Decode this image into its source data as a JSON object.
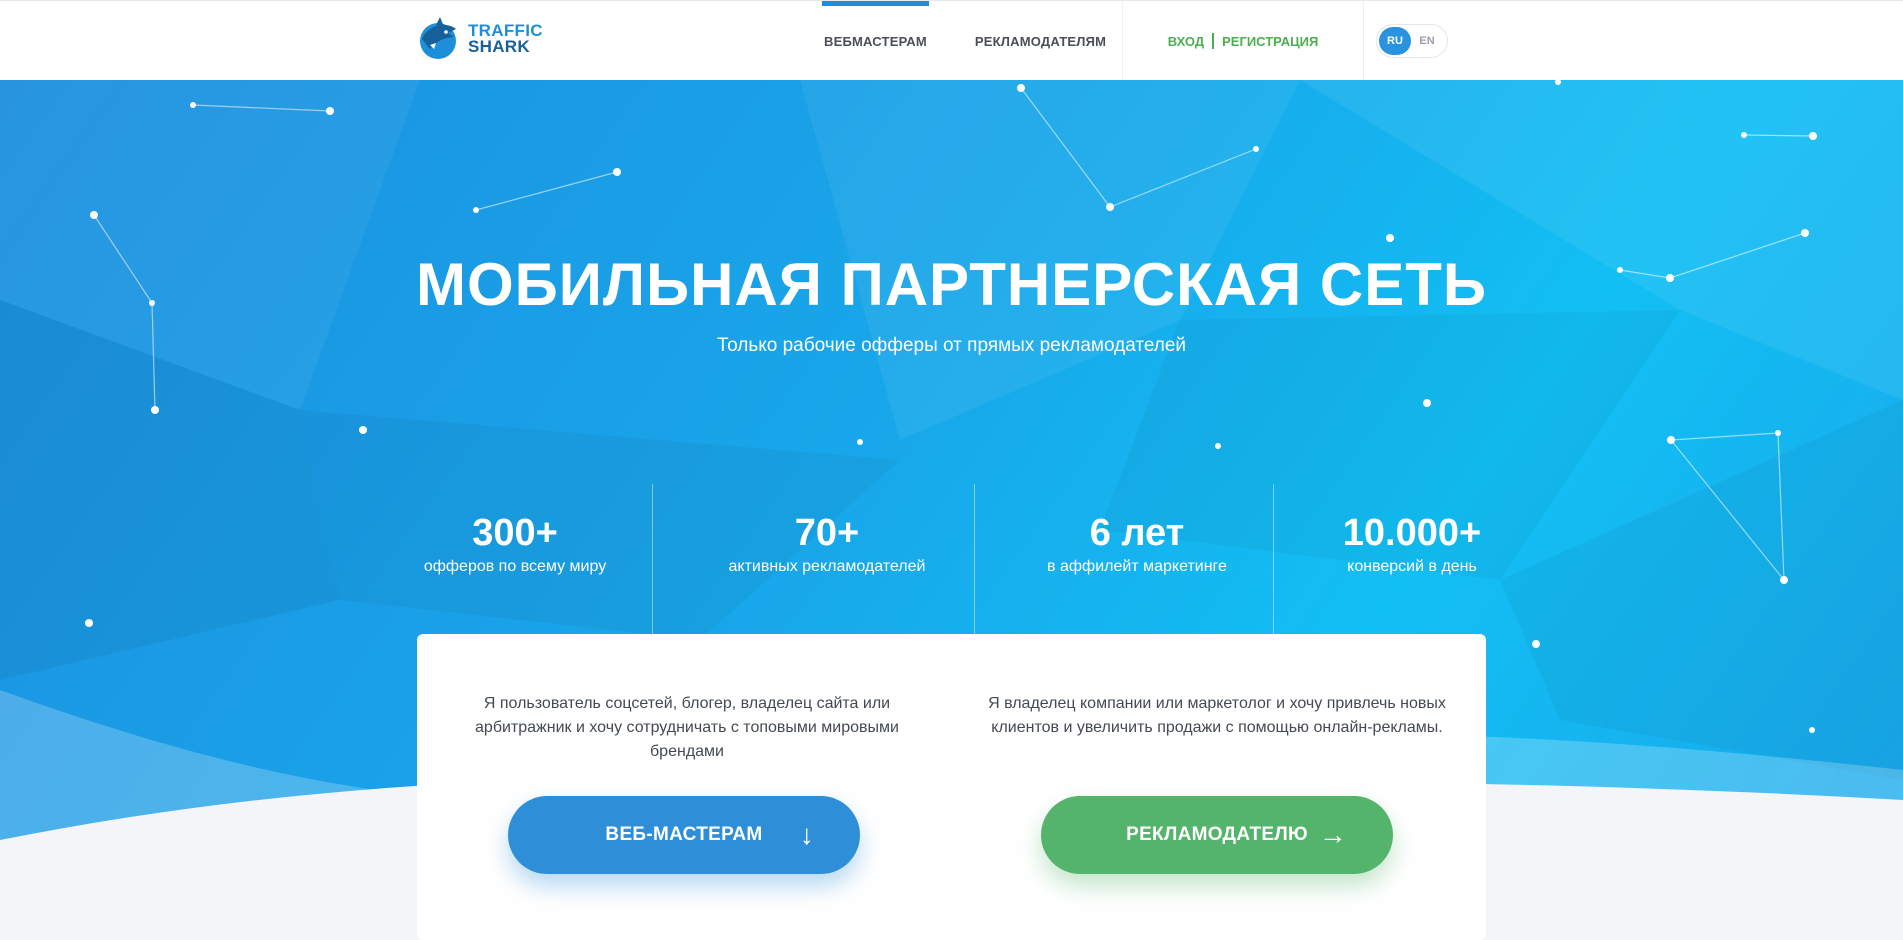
{
  "header": {
    "logo_line1": "TRAFFIC",
    "logo_line2": "SHARK",
    "nav": [
      {
        "label": "ВЕБМАСТЕРАМ",
        "active": true
      },
      {
        "label": "РЕКЛАМОДАТЕЛЯМ",
        "active": false
      }
    ],
    "login_label": "ВХОД",
    "register_label": "РЕГИСТРАЦИЯ",
    "lang": {
      "ru": "RU",
      "en": "EN",
      "selected": "RU"
    }
  },
  "hero": {
    "title": "МОБИЛЬНАЯ ПАРТНЕРСКАЯ СЕТЬ",
    "subtitle": "Только рабочие офферы от прямых рекламодателей"
  },
  "stats": [
    {
      "value": "300+",
      "label": "офферов по всему миру"
    },
    {
      "value": "70+",
      "label": "активных рекламодателей"
    },
    {
      "value": "6 лет",
      "label": "в аффилейт маркетинге"
    },
    {
      "value": "10.000+",
      "label": "конверсий в день"
    }
  ],
  "card": {
    "left_text": "Я пользователь соцсетей, блогер, владелец сайта или арбитражник и хочу сотрудничать с топовыми мировыми брендами",
    "right_text": "Я владелец компании или маркетолог и хочу привлечь новых клиентов и увеличить продажи с помощью онлайн-рекламы.",
    "webmaster_button": "ВЕБ-МАСТЕРАМ",
    "advertiser_button": "РЕКЛАМОДАТЕЛЮ",
    "webmaster_arrow": "↓",
    "advertiser_arrow": "→"
  },
  "colors": {
    "primary_blue": "#2e8fd8",
    "accent_green": "#55b46b",
    "hero_gradient_start": "#1d8fdf",
    "hero_gradient_end": "#12bff4"
  }
}
